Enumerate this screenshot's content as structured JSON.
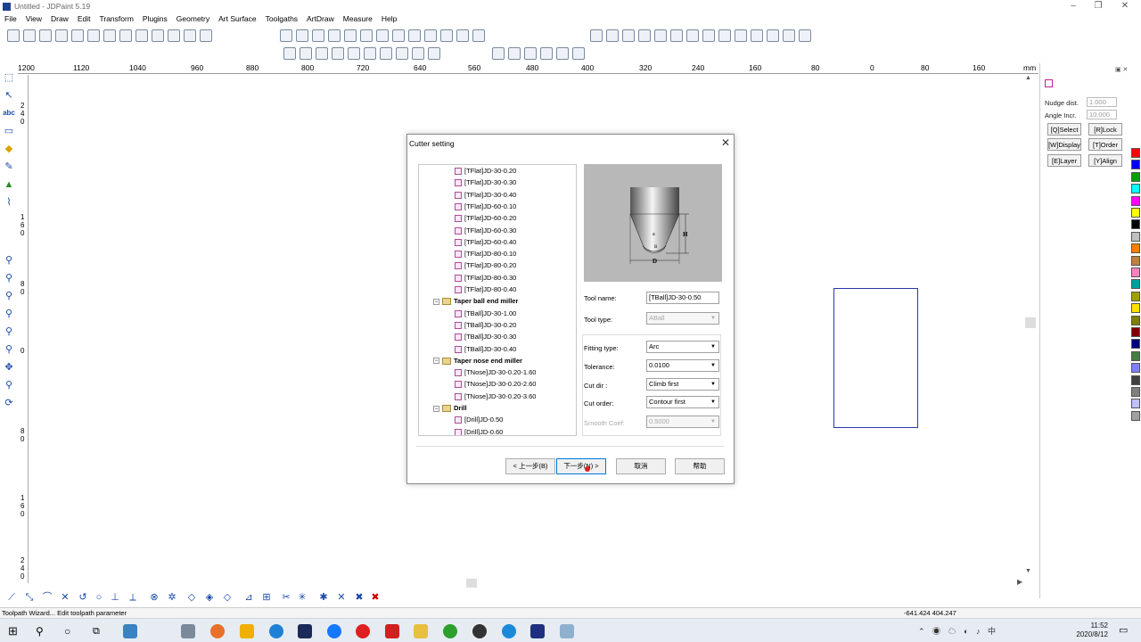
{
  "window": {
    "title": "Untitled - JDPaint 5.19"
  },
  "menu": [
    "File",
    "View",
    "Draw",
    "Edit",
    "Transform",
    "Plugins",
    "Geometry",
    "Art Surface",
    "Toolgaths",
    "ArtDraw",
    "Measure",
    "Help"
  ],
  "ruler": {
    "unit": "mm",
    "labels": [
      "1200",
      "1120",
      "1040",
      "960",
      "880",
      "800",
      "720",
      "640",
      "560",
      "480",
      "400",
      "320",
      "240",
      "160",
      "80",
      "0",
      "80",
      "160"
    ]
  },
  "vruler": {
    "labels": [
      "2 4 0",
      "1 6 0",
      "8 0",
      "0",
      "8 0",
      "1 6 0",
      "2 4 0"
    ]
  },
  "right_panel": {
    "nudge_label": "Nudge dist.",
    "nudge_value": "1.000",
    "angle_label": "Angle Incr.",
    "angle_value": "10.000",
    "buttons": [
      "[Q]Select",
      "[R]Lock",
      "[W]Display",
      "[T]Order",
      "[E]Layer",
      "[Y]Align"
    ]
  },
  "palette_colors": [
    "#ff0000",
    "#0000ff",
    "#00a000",
    "#00ffff",
    "#ff00ff",
    "#ffff00",
    "#000000",
    "#c0c0c0",
    "#ff8000",
    "#c08040",
    "#ff80c0",
    "#00a0a0",
    "#a0a000",
    "#ffe000",
    "#808000",
    "#800000",
    "#000080",
    "#408040",
    "#8080ff",
    "#404040",
    "#808080",
    "#c0c0ff",
    "#a0a0a0"
  ],
  "status": {
    "left": "Toolpath Wizard... Edit toolpath parameter",
    "right": "-641.424 404.247"
  },
  "clock": {
    "time": "11:52",
    "date": "2020/8/12"
  },
  "dialog": {
    "title": "Cutter setting",
    "tree": [
      {
        "type": "leaf",
        "label": "[TFlat]JD-30-0.20"
      },
      {
        "type": "leaf",
        "label": "[TFlat]JD-30-0.30"
      },
      {
        "type": "leaf",
        "label": "[TFlat]JD-30-0.40"
      },
      {
        "type": "leaf",
        "label": "[TFlat]JD-60-0.10"
      },
      {
        "type": "leaf",
        "label": "[TFlat]JD-60-0.20"
      },
      {
        "type": "leaf",
        "label": "[TFlat]JD-60-0.30"
      },
      {
        "type": "leaf",
        "label": "[TFlat]JD-60-0.40"
      },
      {
        "type": "leaf",
        "label": "[TFlat]JD-80-0.10"
      },
      {
        "type": "leaf",
        "label": "[TFlat]JD-80-0.20"
      },
      {
        "type": "leaf",
        "label": "[TFlat]JD-80-0.30"
      },
      {
        "type": "leaf",
        "label": "[TFlat]JD-80-0.40"
      },
      {
        "type": "folder",
        "label": "Taper ball end miller"
      },
      {
        "type": "leaf",
        "label": "[TBall]JD-30-1.00"
      },
      {
        "type": "leaf",
        "label": "[TBall]JD-30-0.20"
      },
      {
        "type": "leaf",
        "label": "[TBall]JD-30-0.30"
      },
      {
        "type": "leaf",
        "label": "[TBall]JD-30-0.40"
      },
      {
        "type": "folder",
        "label": "Taper nose end miller"
      },
      {
        "type": "leaf",
        "label": "[TNose]JD-30-0.20-1.60"
      },
      {
        "type": "leaf",
        "label": "[TNose]JD-30-0.20-2.60"
      },
      {
        "type": "leaf",
        "label": "[TNose]JD-30-0.20-3.60"
      },
      {
        "type": "folder",
        "label": "Drill"
      },
      {
        "type": "leaf",
        "label": "[Drill]JD-0.50"
      },
      {
        "type": "leaf",
        "label": "[Drill]JD-0.60"
      }
    ],
    "image": {
      "label_d": "D",
      "label_h": "H",
      "label_a": "a",
      "label_b": "B"
    },
    "tool_name": {
      "label": "Tool name:",
      "value": "[TBall]JD-30-0.50"
    },
    "tool_type": {
      "label": "Tool type:",
      "value": "ABall"
    },
    "fitting_type": {
      "label": "Fitting type:",
      "value": "Arc"
    },
    "tolerance": {
      "label": "Tolerance:",
      "value": "0.0100"
    },
    "cut_dir": {
      "label": "Cut dir :",
      "value": "Climb first"
    },
    "cut_order": {
      "label": "Cut order:",
      "value": "Contour first"
    },
    "smooth": {
      "label": "Smooth Coef:",
      "value": "0.5000"
    },
    "buttons": {
      "back": "< 上一步(B)",
      "next": "下一步(N) >",
      "cancel": "取消",
      "help": "帮助"
    }
  }
}
